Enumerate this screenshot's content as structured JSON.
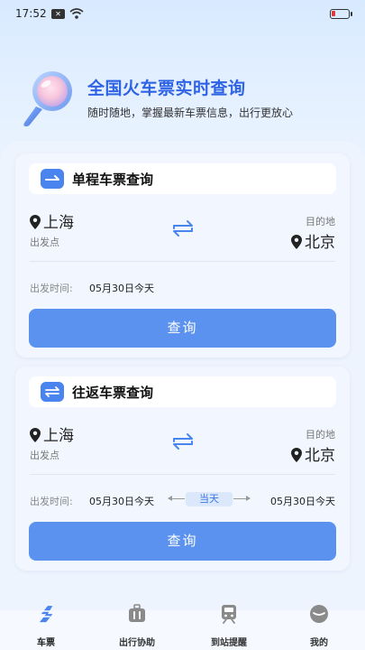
{
  "status_bar": {
    "time": "17:52"
  },
  "hero": {
    "title": "全国火车票实时查询",
    "subtitle": "随时随地，掌握最新车票信息，出行更放心"
  },
  "single_trip": {
    "title": "单程车票查询",
    "from_city": "上海",
    "from_label": "出发点",
    "to_label": "目的地",
    "to_city": "北京",
    "date_label": "出发时间:",
    "date_value": "05月30日今天",
    "query_label": "查询"
  },
  "round_trip": {
    "title": "往返车票查询",
    "from_city": "上海",
    "from_label": "出发点",
    "to_label": "目的地",
    "to_city": "北京",
    "date_label": "出发时间:",
    "depart_value": "05月30日今天",
    "same_day_label": "当天",
    "return_value": "05月30日今天",
    "query_label": "查询"
  },
  "tabbar": {
    "items": [
      {
        "label": "车票",
        "icon": "ticket-icon"
      },
      {
        "label": "出行协助",
        "icon": "luggage-icon"
      },
      {
        "label": "到站提醒",
        "icon": "train-icon"
      },
      {
        "label": "我的",
        "icon": "profile-icon"
      }
    ],
    "active_color": "#3c78e6"
  },
  "colors": {
    "accent": "#2e63e6",
    "button": "#5b92ef"
  }
}
